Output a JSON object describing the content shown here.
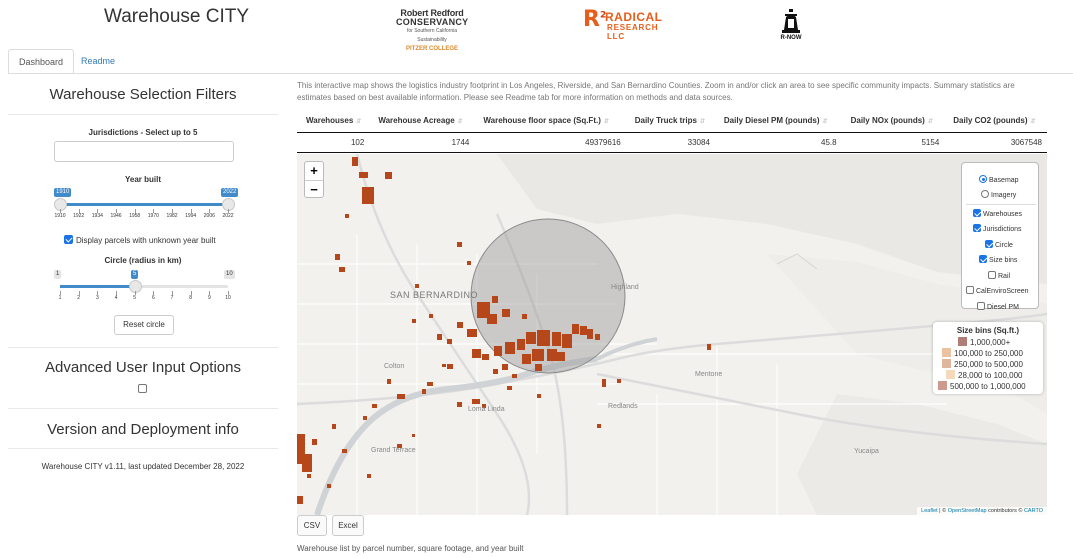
{
  "app": {
    "title": "Warehouse CITY"
  },
  "logos": {
    "rrc": {
      "line1": "Robert Redford",
      "line2": "CONSERVANCY",
      "line3": "for Southern California Sustainability",
      "line4": "PITZER COLLEGE"
    },
    "radical": {
      "mark": "R",
      "sup": "2",
      "word1": "RADICAL",
      "word2": "RESEARCH LLC"
    },
    "rnow": {
      "text": "R-NOW"
    }
  },
  "tabs": [
    {
      "label": "Dashboard",
      "active": true
    },
    {
      "label": "Readme",
      "active": false
    }
  ],
  "sidebar": {
    "filters_title": "Warehouse Selection Filters",
    "jurisdictions_label": "Jurisdictions - Select up to 5",
    "jurisdictions_value": "",
    "year_built": {
      "label": "Year built",
      "min": 1910,
      "max": 2022,
      "from": 1910,
      "to": 2022,
      "ticks": [
        "1910",
        "1922",
        "1934",
        "1946",
        "1958",
        "1970",
        "1982",
        "1994",
        "2006",
        "2022"
      ],
      "min_text": "1910",
      "max_text": "2022"
    },
    "unknown_year": {
      "label": "Display parcels with unknown year built",
      "checked": true
    },
    "circle": {
      "label": "Circle (radius in km)",
      "min": 1,
      "max": 10,
      "value": 5,
      "ticks": [
        "1",
        "2",
        "3",
        "4",
        "5",
        "6",
        "7",
        "8",
        "9",
        "10"
      ],
      "min_text": "1",
      "max_text": "10",
      "value_text": "5"
    },
    "reset_label": "Reset circle",
    "advanced_title": "Advanced User Input Options",
    "advanced_checked": false,
    "version_title": "Version and Deployment info",
    "version_text": "Warehouse CITY v1.11, last updated December 28, 2022"
  },
  "main": {
    "intro": "This interactive map shows the logistics industry footprint in Los Angeles, Riverside, and San Bernardino Counties. Zoom in and/or click an area to see specific community impacts. Summary statistics are estimates based on best available information. Please see Readme tab for more information on methods and data sources.",
    "table": {
      "headers": [
        "Warehouses",
        "Warehouse Acreage",
        "Warehouse floor space (Sq.Ft.)",
        "Daily Truck trips",
        "Daily Diesel PM (pounds)",
        "Daily NOx (pounds)",
        "Daily CO2 (pounds)"
      ],
      "row": [
        "102",
        "1744",
        "49379616",
        "33084",
        "45.8",
        "5154",
        "3067548"
      ]
    },
    "map": {
      "zoom_in": "+",
      "zoom_out": "−",
      "base_layers": [
        {
          "label": "Basemap",
          "selected": true
        },
        {
          "label": "Imagery",
          "selected": false
        }
      ],
      "overlays": [
        {
          "label": "Warehouses",
          "checked": true
        },
        {
          "label": "Jurisdictions",
          "checked": true
        },
        {
          "label": "Circle",
          "checked": true
        },
        {
          "label": "Size bins",
          "checked": true
        },
        {
          "label": "Rail",
          "checked": false
        },
        {
          "label": "CalEnviroScreen",
          "checked": false
        },
        {
          "label": "Diesel PM",
          "checked": false
        }
      ],
      "legend": {
        "title": "Size bins (Sq.ft.)",
        "items": [
          {
            "label": "1,000,000+",
            "color": "#a0675f"
          },
          {
            "label": "100,000 to 250,000",
            "color": "#e8b98f"
          },
          {
            "label": "250,000 to 500,000",
            "color": "#d9a98a"
          },
          {
            "label": "28,000 to 100,000",
            "color": "#f2d2b0"
          },
          {
            "label": "500,000 to 1,000,000",
            "color": "#c4877a"
          }
        ]
      },
      "places": {
        "san_bernardino": "SAN BERNARDINO",
        "highland": "Highland",
        "colton": "Colton",
        "mentone": "Mentone",
        "loma_linda": "Loma Linda",
        "redlands": "Redlands",
        "grand_terrace": "Grand Terrace",
        "yucaipa": "Yucaipa"
      },
      "attribution": {
        "leaflet": "Leaflet",
        "sep1": " | © ",
        "osm": "OpenStreetMap",
        "mid": " contributors © ",
        "carto": "CARTO"
      },
      "warehouse_color": "#b5471b",
      "circle_color": "#888888"
    },
    "buttons": {
      "csv": "CSV",
      "excel": "Excel"
    },
    "caption": "Warehouse list by parcel number, square footage, and year built"
  }
}
